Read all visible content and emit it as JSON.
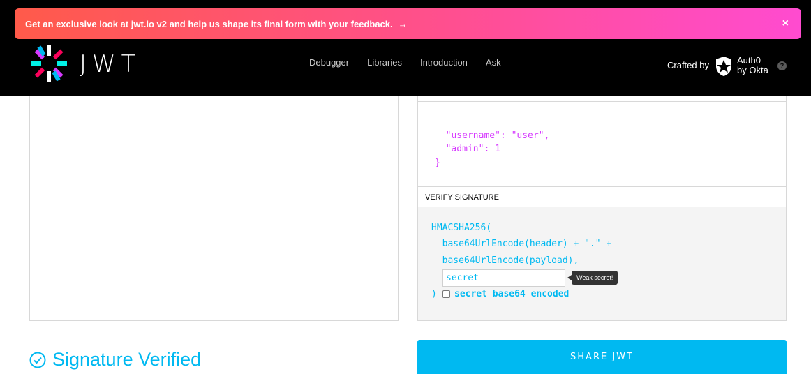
{
  "banner": {
    "text": "Get an exclusive look at jwt.io v2 and help us shape its final form with your feedback.",
    "arrow": "→",
    "close": "×"
  },
  "header": {
    "logo_word": "JWT",
    "nav": [
      "Debugger",
      "Libraries",
      "Introduction",
      "Ask"
    ],
    "crafted_by": "Crafted by",
    "auth0_line1": "Auth0",
    "auth0_line2": "by Okta",
    "help": "?"
  },
  "payload": {
    "line1": "  \"username\": \"user\",",
    "line2": "  \"admin\": 1",
    "line3": "}"
  },
  "verify": {
    "header": "VERIFY SIGNATURE",
    "line1": "HMACSHA256(",
    "line2": "  base64UrlEncode(header) + \".\" +",
    "line3": "  base64UrlEncode(payload),",
    "secret_value": "secret",
    "weak_tip": "Weak secret!",
    "close_paren": ")",
    "b64_label": "secret base64 encoded",
    "b64_checked": false
  },
  "status": {
    "verified_text": "Signature Verified"
  },
  "share": {
    "label": "SHARE JWT"
  },
  "colors": {
    "accent": "#00b9f1",
    "payload": "#d63aff",
    "header_bg": "#000000",
    "banner_start": "#ff5a4a",
    "banner_end": "#ff4bd0"
  }
}
